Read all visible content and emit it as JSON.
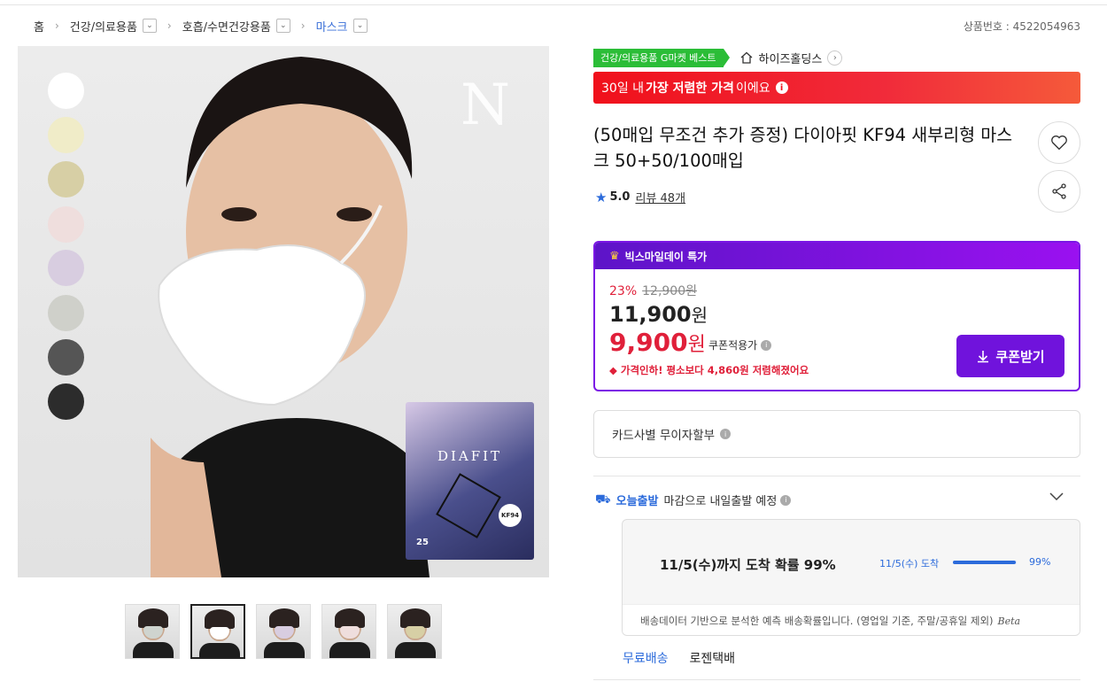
{
  "breadcrumb": {
    "items": [
      "홈",
      "건강/의료용품",
      "호흡/수면건강용품",
      "마스크"
    ]
  },
  "product_number": "상품번호 : 4522054963",
  "image": {
    "swatch_colors": [
      "#ffffff",
      "#f0ecc8",
      "#d7cfa5",
      "#efdedd",
      "#d8cde0",
      "#cfd0ca",
      "#555555",
      "#2c2c2c"
    ],
    "logo_letter": "N",
    "package_brand": "DIAFIT",
    "package_badge": "KF94",
    "package_count": "25"
  },
  "thumbnails": [
    {
      "mask_color": "#cfd4cf",
      "selected": false
    },
    {
      "mask_color": "#ffffff",
      "selected": true
    },
    {
      "mask_color": "#d8cde0",
      "selected": false
    },
    {
      "mask_color": "#efdedd",
      "selected": false
    },
    {
      "mask_color": "#d7cfa5",
      "selected": false
    }
  ],
  "best_badge": "건강/의료용품 G마켓 베스트",
  "seller": "하이즈홀딩스",
  "lowest_banner": {
    "pre": "30일 내 ",
    "bold": "가장 저렴한 가격",
    "post": "이에요"
  },
  "title": "(50매입 무조건 추가 증정) 다이아핏 KF94 새부리형 마스크 50+50/100매입",
  "rating": {
    "score": "5.0",
    "reviews": "리뷰 48개"
  },
  "deal": {
    "header": "빅스마일데이 특가",
    "discount": "23%",
    "original_price": "12,900원",
    "price_number": "11,900",
    "price_unit": "원",
    "coupon_price_number": "9,900",
    "coupon_price_unit": "원",
    "coupon_label": "쿠폰적용가",
    "drop_notice": "가격인하! 평소보다 4,860원 저렴해졌어요",
    "coupon_button": "쿠폰받기"
  },
  "card_installment": "카드사별 무이자할부",
  "shipping": {
    "today_label": "오늘출발",
    "description": "마감으로 내일출발 예정",
    "arrival_text": "11/5(수)까지 도착 확률 99%",
    "arrival_date": "11/5(수) 도착",
    "probability": 0.99,
    "probability_label": "99%",
    "note": "배송데이터 기반으로 분석한 예측 배송확률입니다. (영업일 기준, 주말/공휴일 제외)",
    "beta": "Beta",
    "fee": "무료배송",
    "carrier": "로젠택배"
  },
  "colors": {
    "accent_purple": "#7013dc",
    "accent_red": "#e0203a",
    "accent_blue": "#2c6bdb",
    "badge_green": "#2bbd37"
  }
}
